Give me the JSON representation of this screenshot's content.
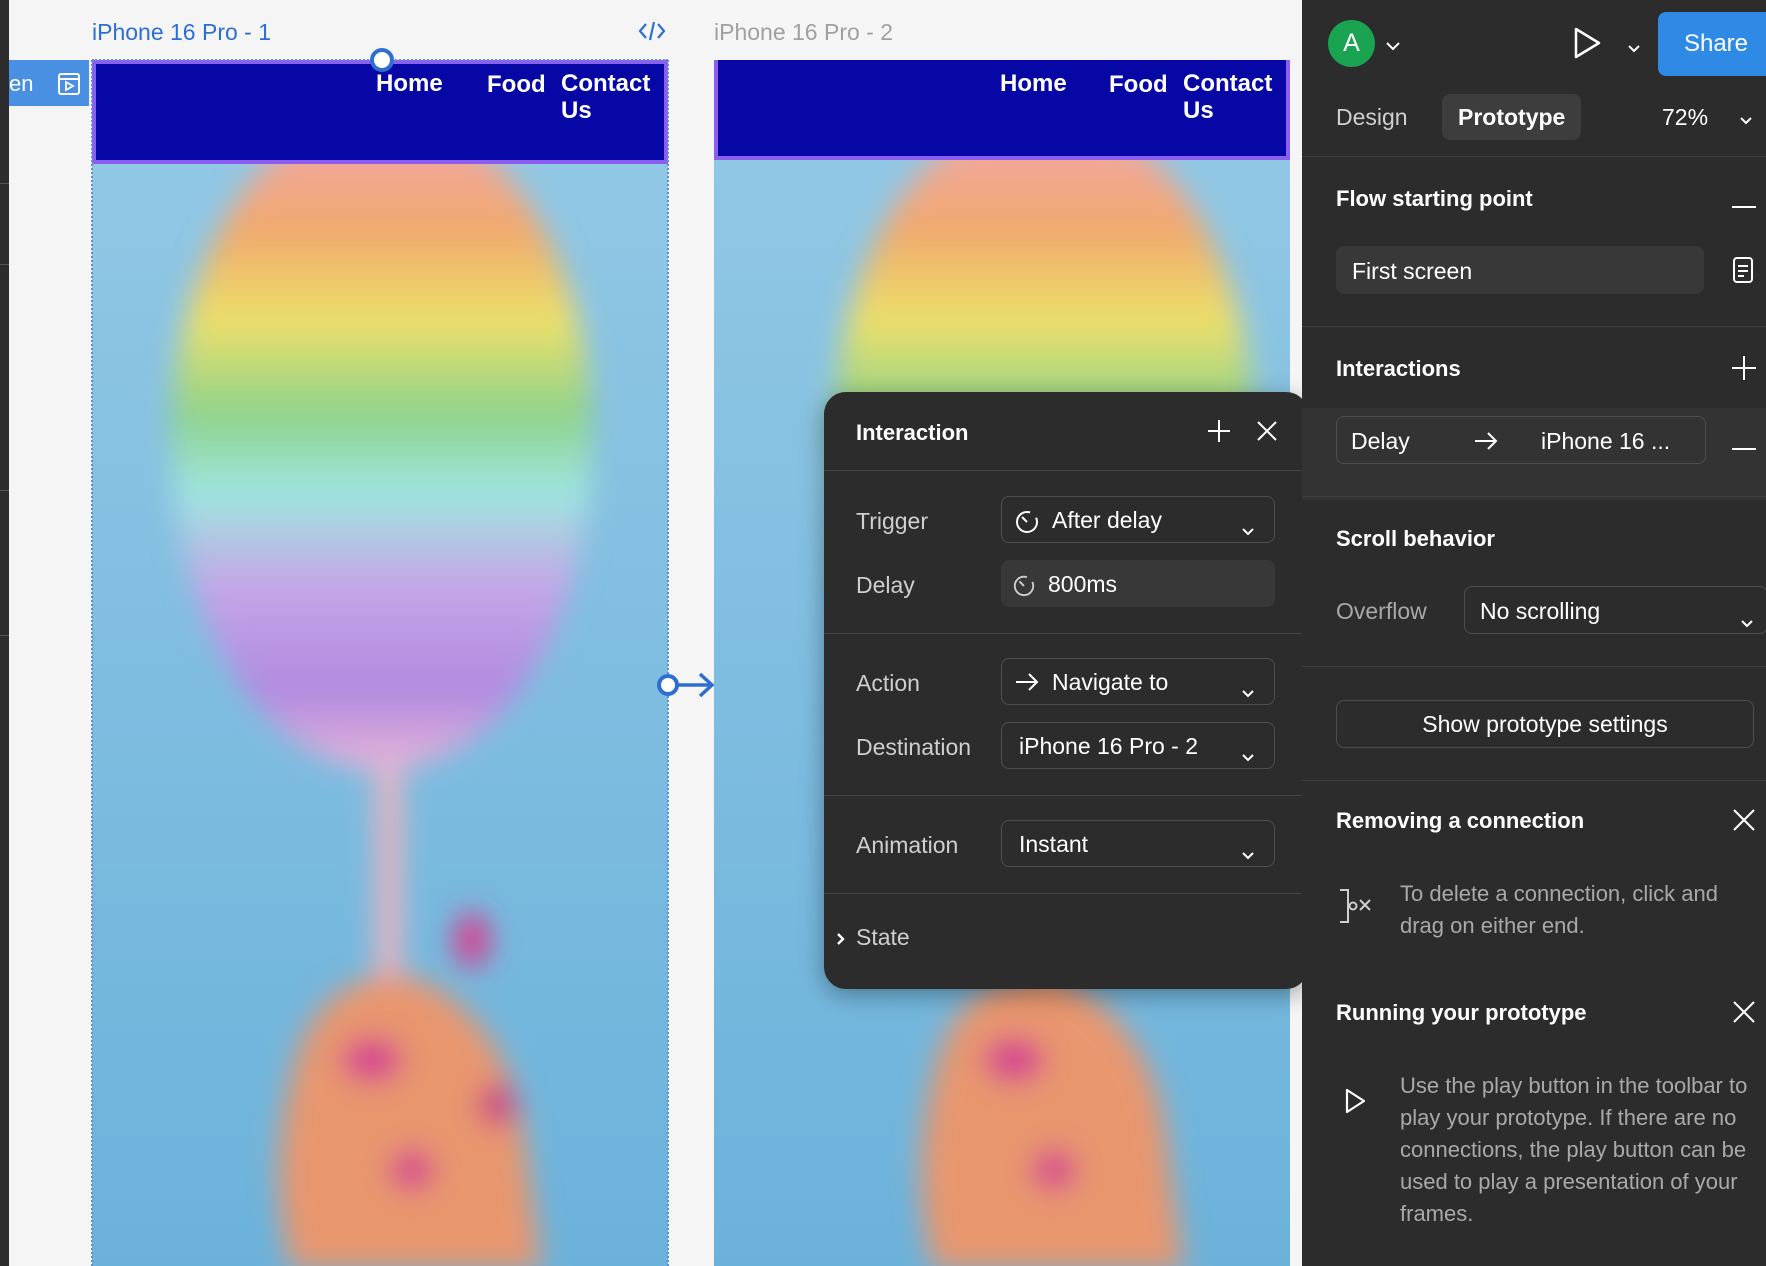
{
  "canvas": {
    "flow_tag_label": "en",
    "frame1_label": "iPhone 16 Pro - 1",
    "frame2_label": "iPhone 16 Pro - 2",
    "nav": {
      "home": "Home",
      "food": "Food",
      "contact": "Contact Us"
    }
  },
  "popup": {
    "title": "Interaction",
    "trigger_label": "Trigger",
    "trigger_value": "After delay",
    "delay_label": "Delay",
    "delay_value": "800ms",
    "action_label": "Action",
    "action_value": "Navigate to",
    "destination_label": "Destination",
    "destination_value": "iPhone 16 Pro - 2",
    "animation_label": "Animation",
    "animation_value": "Instant",
    "state_label": "State"
  },
  "panel": {
    "avatar_letter": "A",
    "share_label": "Share",
    "tabs": {
      "design": "Design",
      "prototype": "Prototype"
    },
    "zoom": "72%",
    "flow": {
      "title": "Flow starting point",
      "value": "First screen"
    },
    "interactions": {
      "title": "Interactions",
      "trigger": "Delay",
      "destination": "iPhone 16 ..."
    },
    "scroll": {
      "title": "Scroll behavior",
      "overflow_label": "Overflow",
      "overflow_value": "No scrolling"
    },
    "show_settings": "Show prototype settings",
    "removing": {
      "title": "Removing a connection",
      "text": "To delete a connection, click and drag on either end."
    },
    "running": {
      "title": "Running your prototype",
      "text": "Use the play button in the toolbar to play your prototype. If there are no connections, the play button can be used to play a presentation of your frames."
    }
  },
  "colors": {
    "accent_blue": "#2f8ae6",
    "navbar": "#0707a6",
    "selection": "#8c5ef0",
    "avatar": "#1aa351",
    "panel_bg": "#2c2c2c"
  }
}
